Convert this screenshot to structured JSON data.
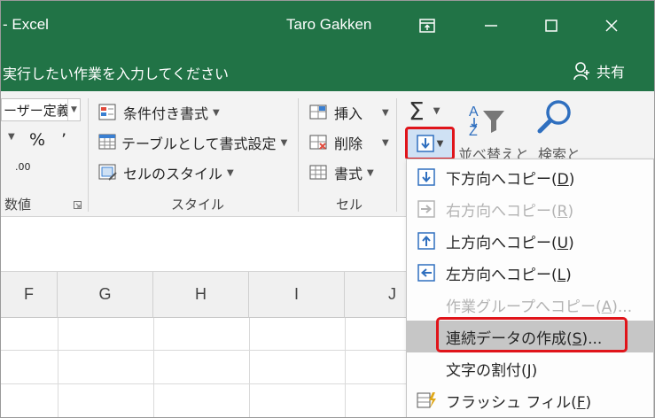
{
  "titlebar": {
    "app_title": "- Excel",
    "user_name": "Taro Gakken"
  },
  "tellbar": {
    "tell_me_text": "実行したい作業を入力してください",
    "share_label": "共有"
  },
  "ribbon": {
    "number_format_value": "ーザー定義",
    "percent_label": "%",
    "comma_label": "’",
    "decimal_label": ".00",
    "number_group_label": "数値",
    "conditional_format_label": "条件付き書式",
    "format_as_table_label": "テーブルとして書式設定",
    "cell_styles_label": "セルのスタイル",
    "styles_group_label": "スタイル",
    "insert_label": "挿入",
    "delete_label": "削除",
    "format_label": "書式",
    "cells_group_label": "セル",
    "sort_filter_label": "並べ替えと",
    "find_select_label": "検索と"
  },
  "columns": [
    "F",
    "G",
    "H",
    "I",
    "J"
  ],
  "fill_menu": {
    "items": [
      {
        "label": "下方向へコピー(",
        "key": "D",
        "suffix": ")",
        "disabled": false,
        "icon": "fill-down-icon"
      },
      {
        "label": "右方向へコピー(",
        "key": "R",
        "suffix": ")",
        "disabled": true,
        "icon": "fill-right-icon"
      },
      {
        "label": "上方向へコピー(",
        "key": "U",
        "suffix": ")",
        "disabled": false,
        "icon": "fill-up-icon"
      },
      {
        "label": "左方向へコピー(",
        "key": "L",
        "suffix": ")",
        "disabled": false,
        "icon": "fill-left-icon"
      },
      {
        "label": "作業グループへコピー(",
        "key": "A",
        "suffix": ")...",
        "disabled": true,
        "icon": ""
      },
      {
        "label": "連続データの作成(",
        "key": "S",
        "suffix": ")...",
        "disabled": false,
        "icon": ""
      },
      {
        "label": "文字の割付(",
        "key": "J",
        "suffix": ")",
        "disabled": false,
        "icon": ""
      },
      {
        "label": "フラッシュ フィル(",
        "key": "F",
        "suffix": ")",
        "disabled": false,
        "icon": "flash-fill-icon"
      }
    ]
  },
  "colors": {
    "excel_green": "#217346",
    "highlight_red": "#e0141a",
    "fill_blue": "#2f6fbf"
  }
}
